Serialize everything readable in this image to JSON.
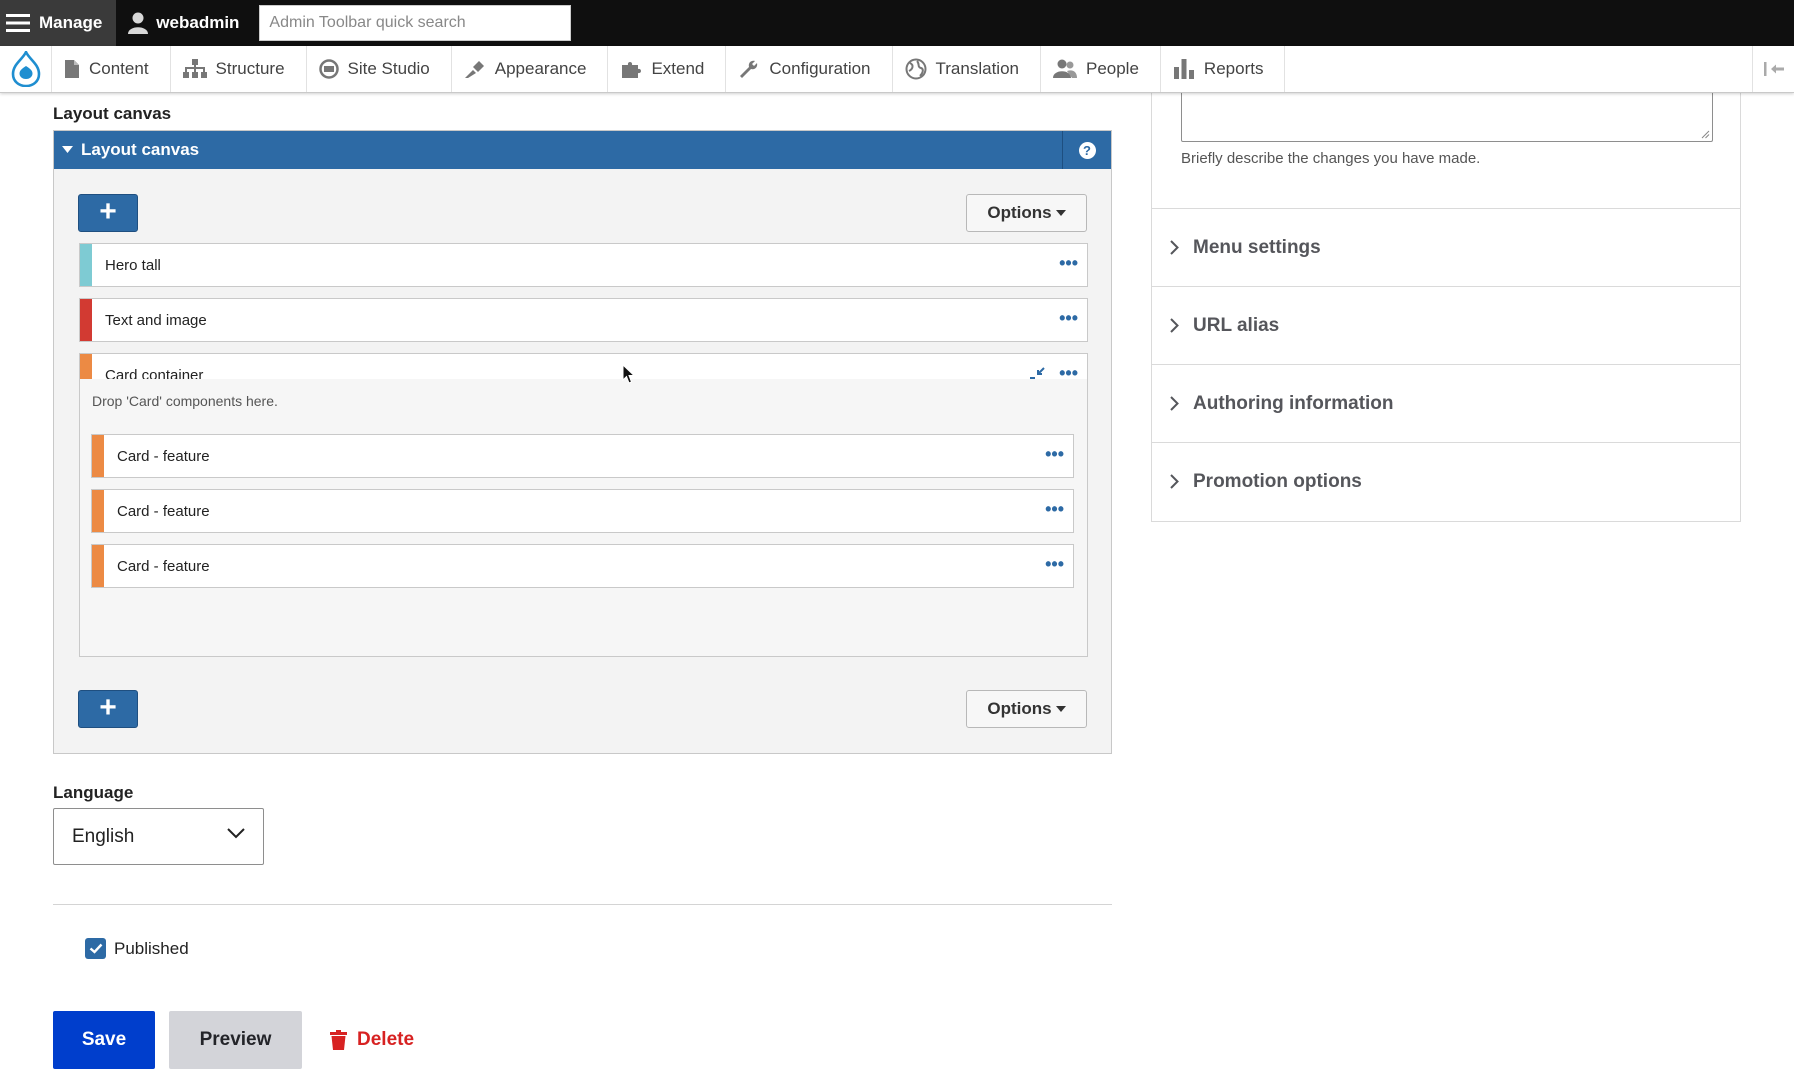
{
  "toolbar": {
    "manage_label": "Manage",
    "user_label": "webadmin",
    "search_placeholder": "Admin Toolbar quick search"
  },
  "tray": {
    "items": [
      {
        "label": "Content",
        "icon": "file-icon"
      },
      {
        "label": "Structure",
        "icon": "sitemap-icon"
      },
      {
        "label": "Site Studio",
        "icon": "site-studio-icon"
      },
      {
        "label": "Appearance",
        "icon": "paintbrush-icon"
      },
      {
        "label": "Extend",
        "icon": "puzzle-icon"
      },
      {
        "label": "Configuration",
        "icon": "wrench-icon"
      },
      {
        "label": "Translation",
        "icon": "globe-icon"
      },
      {
        "label": "People",
        "icon": "people-icon"
      },
      {
        "label": "Reports",
        "icon": "bar-chart-icon"
      }
    ]
  },
  "layout_canvas": {
    "section_title": "Layout canvas",
    "panel_title": "Layout canvas",
    "options_label": "Options",
    "add_label": "+",
    "components": [
      {
        "label": "Hero tall",
        "color": "#7ecbd3"
      },
      {
        "label": "Text and image",
        "color": "#d23a32"
      },
      {
        "label": "Card container",
        "color": "#ec8a44"
      }
    ],
    "drop_hint": "Drop 'Card' components here.",
    "cards": [
      {
        "label": "Card - feature",
        "color": "#ec8a44"
      },
      {
        "label": "Card - feature",
        "color": "#ec8a44"
      },
      {
        "label": "Card - feature",
        "color": "#ec8a44"
      }
    ]
  },
  "language": {
    "label": "Language",
    "selected": "English"
  },
  "published": {
    "label": "Published",
    "checked": true
  },
  "actions": {
    "save": "Save",
    "preview": "Preview",
    "delete": "Delete"
  },
  "sidebar": {
    "revision_hint": "Briefly describe the changes you have made.",
    "sections": [
      {
        "label": "Menu settings"
      },
      {
        "label": "URL alias"
      },
      {
        "label": "Authoring information"
      },
      {
        "label": "Promotion options"
      }
    ]
  },
  "colors": {
    "accent": "#2d6aa5",
    "save": "#003ecc",
    "delete": "#d72222"
  }
}
